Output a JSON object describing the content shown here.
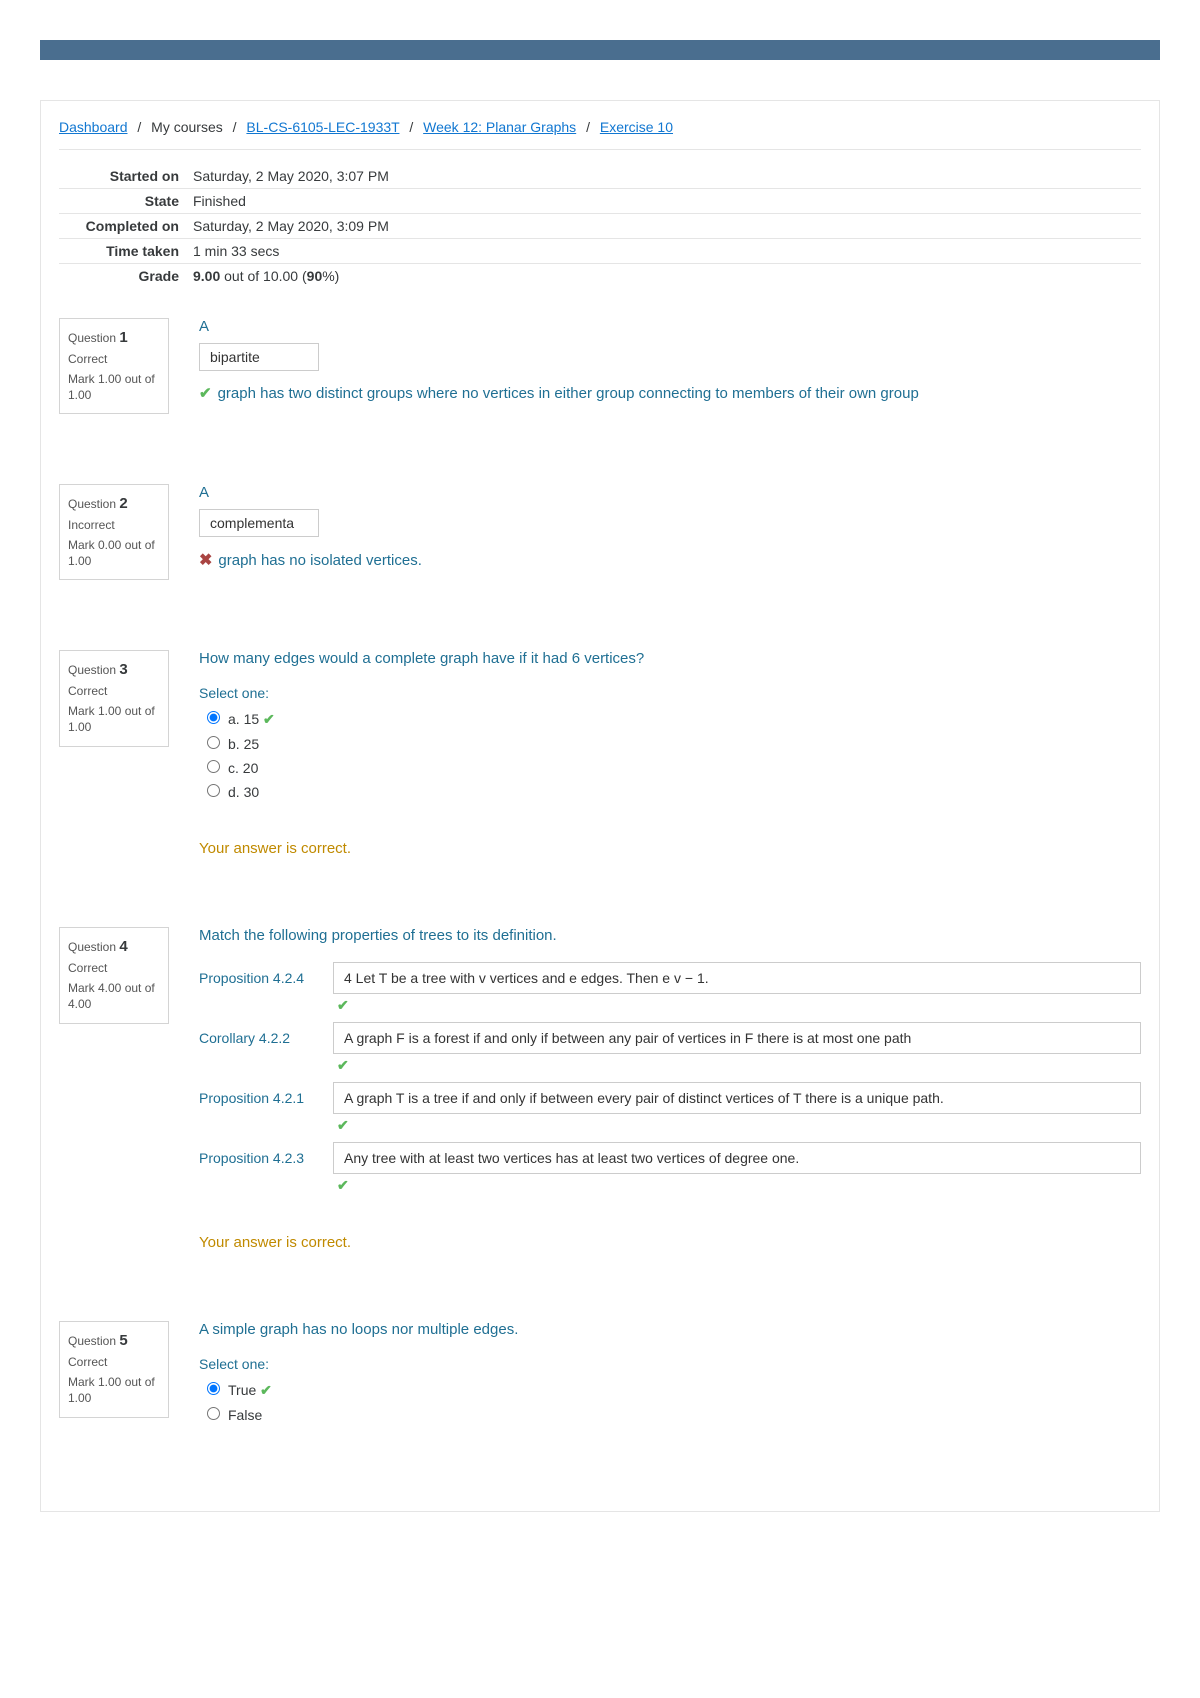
{
  "breadcrumb": {
    "dashboard": "Dashboard",
    "mycourses": "My courses",
    "course": "BL-CS-6105-LEC-1933T",
    "week": "Week 12: Planar Graphs",
    "activity": "Exercise 10"
  },
  "summary": {
    "started_label": "Started on",
    "started_value": "Saturday, 2 May 2020, 3:07 PM",
    "state_label": "State",
    "state_value": "Finished",
    "completed_label": "Completed on",
    "completed_value": "Saturday, 2 May 2020, 3:09 PM",
    "time_label": "Time taken",
    "time_value": "1 min 33 secs",
    "grade_label": "Grade",
    "grade_value_a": "9.00",
    "grade_value_b": " out of 10.00 (",
    "grade_value_c": "90",
    "grade_value_d": "%)"
  },
  "q1": {
    "word": "Question ",
    "num": "1",
    "state": "Correct",
    "mark": "Mark 1.00 out of 1.00",
    "prefix": "A",
    "value": "bipartite",
    "feedback": "graph has two distinct groups where no vertices in either group connecting to members of their own group"
  },
  "q2": {
    "word": "Question ",
    "num": "2",
    "state": "Incorrect",
    "mark": "Mark 0.00 out of 1.00",
    "prefix": "A",
    "value": "complementa",
    "feedback": "graph has no isolated vertices."
  },
  "q3": {
    "word": "Question ",
    "num": "3",
    "state": "Correct",
    "mark": "Mark 1.00 out of 1.00",
    "text": "How many edges would a complete graph have if it had 6 vertices?",
    "select": "Select one:",
    "a": "a. 15",
    "b": "b. 25",
    "c": "c. 20",
    "d": "d. 30",
    "fb": "Your answer is correct."
  },
  "q4": {
    "word": "Question ",
    "num": "4",
    "state": "Correct",
    "mark": "Mark 4.00 out of 4.00",
    "text": "Match the following properties of trees to its definition.",
    "r1l": "Proposition 4.2.4",
    "r1v": "4 Let T be a tree with v vertices and e edges. Then e v − 1.",
    "r2l": "Corollary 4.2.2",
    "r2v": "A graph F is a forest if and only if between any pair of vertices in F there is at most one path",
    "r3l": "Proposition 4.2.1",
    "r3v": "A graph T is a tree if and only if between every pair of distinct vertices of T there is a unique path.",
    "r4l": "Proposition 4.2.3",
    "r4v": "Any tree with at least two vertices has at least two vertices of degree one.",
    "fb": "Your answer is correct."
  },
  "q5": {
    "word": "Question ",
    "num": "5",
    "state": "Correct",
    "mark": "Mark 1.00 out of 1.00",
    "text": "A simple graph has no loops nor multiple edges.",
    "select": "Select one:",
    "t": "True",
    "f": "False"
  }
}
